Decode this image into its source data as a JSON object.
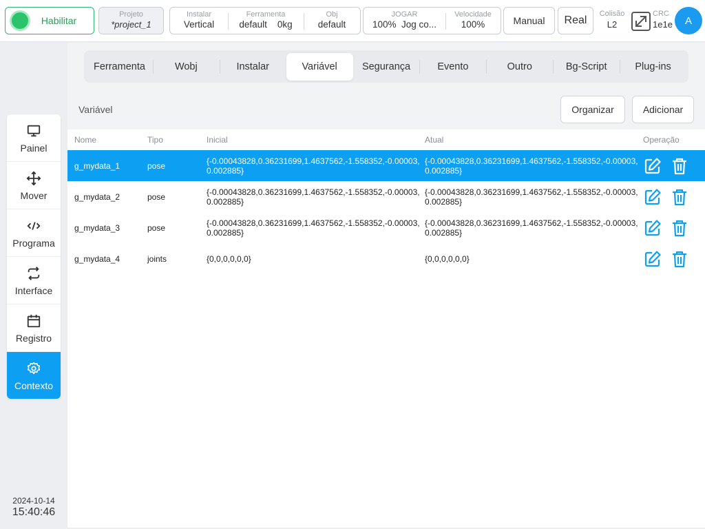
{
  "topbar": {
    "enable_label": "Habilitar",
    "project": {
      "caption": "Projeto",
      "value": "*project_1"
    },
    "install": {
      "caption": "Instalar",
      "value": "Vertical"
    },
    "tool": {
      "caption": "Ferramenta",
      "value": "default",
      "weight": "0kg"
    },
    "obj": {
      "caption": "Obj",
      "value": "default"
    },
    "jog": {
      "caption": "JOGAR",
      "percent": "100%",
      "mode": "Jog co..."
    },
    "speed": {
      "caption": "Velocidade",
      "value": "100%"
    },
    "manual_label": "Manual",
    "real_label": "Real",
    "collision": {
      "caption": "Colisão",
      "value": "L2"
    },
    "crc": {
      "caption": "CRC",
      "value": "1e1e"
    },
    "avatar_letter": "A",
    "expand_icon": "expand-icon",
    "colors": {
      "enable_green": "#2bc46b",
      "accent_blue": "#0d9ff2"
    }
  },
  "sidebar": {
    "items": [
      {
        "label": "Painel",
        "icon": "monitor-icon",
        "active": false
      },
      {
        "label": "Mover",
        "icon": "move-arrows-icon",
        "active": false
      },
      {
        "label": "Programa",
        "icon": "code-icon",
        "active": false
      },
      {
        "label": "Interface",
        "icon": "swap-arrows-icon",
        "active": false
      },
      {
        "label": "Registro",
        "icon": "calendar-icon",
        "active": false
      },
      {
        "label": "Contexto",
        "icon": "gear-icon",
        "active": true
      }
    ],
    "date": "2024-10-14",
    "time": "15:40:46"
  },
  "tabs": [
    {
      "label": "Ferramenta",
      "active": false
    },
    {
      "label": "Wobj",
      "active": false
    },
    {
      "label": "Instalar",
      "active": false
    },
    {
      "label": "Variável",
      "active": true
    },
    {
      "label": "Segurança",
      "active": false
    },
    {
      "label": "Evento",
      "active": false
    },
    {
      "label": "Outro",
      "active": false
    },
    {
      "label": "Bg-Script",
      "active": false
    },
    {
      "label": "Plug-ins",
      "active": false
    }
  ],
  "section": {
    "title": "Variável",
    "organize_label": "Organizar",
    "add_label": "Adicionar"
  },
  "table": {
    "headers": {
      "name": "Nome",
      "type": "Tipo",
      "initial": "Inicial",
      "current": "Atual",
      "operation": "Operação"
    },
    "rows": [
      {
        "name": "g_mydata_1",
        "type": "pose",
        "initial": "{-0.00043828,0.36231699,1.4637562,-1.558352,-0.00003,0.002885}",
        "current": "{-0.00043828,0.36231699,1.4637562,-1.558352,-0.00003,0.002885}",
        "selected": true
      },
      {
        "name": "g_mydata_2",
        "type": "pose",
        "initial": "{-0.00043828,0.36231699,1.4637562,-1.558352,-0.00003,0.002885}",
        "current": "{-0.00043828,0.36231699,1.4637562,-1.558352,-0.00003,0.002885}",
        "selected": false
      },
      {
        "name": "g_mydata_3",
        "type": "pose",
        "initial": "{-0.00043828,0.36231699,1.4637562,-1.558352,-0.00003,0.002885}",
        "current": "{-0.00043828,0.36231699,1.4637562,-1.558352,-0.00003,0.002885}",
        "selected": false
      },
      {
        "name": "g_mydata_4",
        "type": "joints",
        "initial": "{0,0,0,0,0,0}",
        "current": "{0,0,0,0,0,0}",
        "selected": false
      }
    ],
    "row_icons": {
      "edit": "edit-icon",
      "delete": "trash-icon"
    }
  }
}
